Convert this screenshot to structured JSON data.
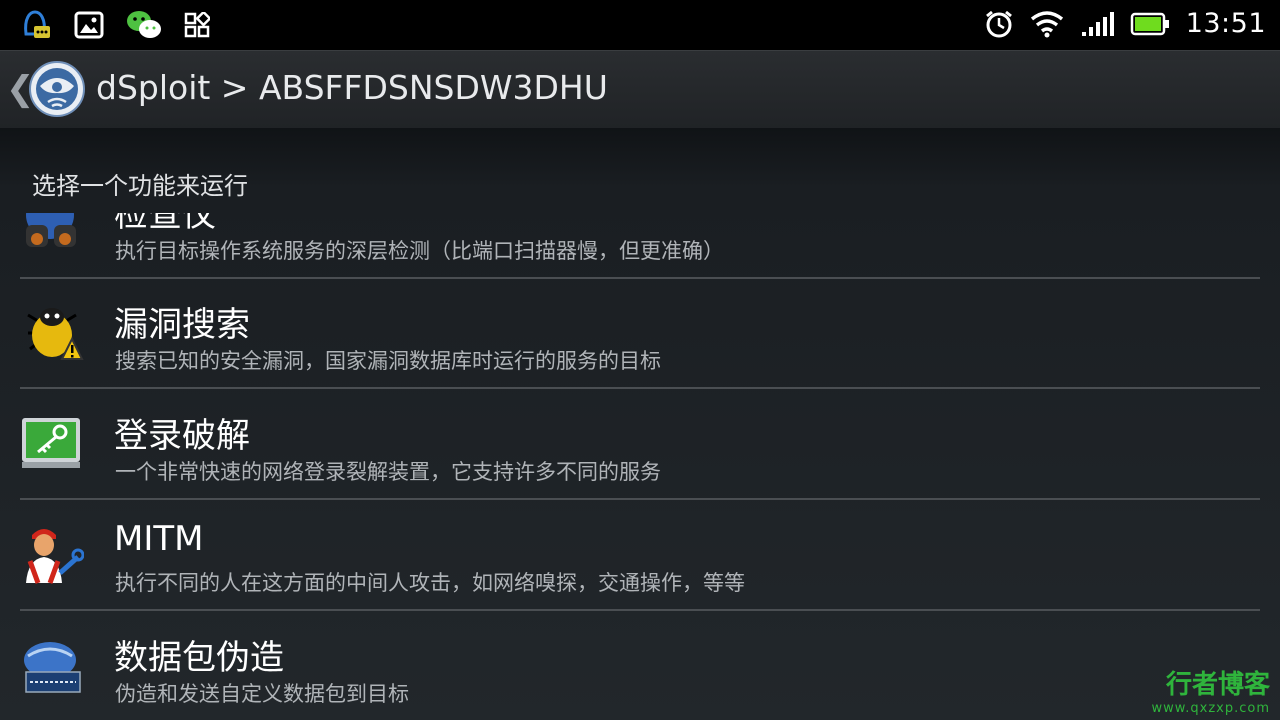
{
  "status_bar": {
    "time": "13:51",
    "left_icons": [
      "qq-icon",
      "gallery-icon",
      "wechat-icon",
      "apps-icon"
    ],
    "right_icons": [
      "alarm-icon",
      "wifi-icon",
      "signal-icon",
      "battery-icon"
    ]
  },
  "action_bar": {
    "back": "❮",
    "title": "dSploit > ABSFFDSNSDW3DHU"
  },
  "section_header": "选择一个功能来运行",
  "items": [
    {
      "title": "检查仪",
      "desc": "执行目标操作系统服务的深层检测（比端口扫描器慢，但更准确）",
      "icon": "binoculars-globe-icon"
    },
    {
      "title": "漏洞搜索",
      "desc": "搜索已知的安全漏洞，国家漏洞数据库时运行的服务的目标",
      "icon": "bug-warning-icon"
    },
    {
      "title": "登录破解",
      "desc": "一个非常快速的网络登录裂解装置，它支持许多不同的服务",
      "icon": "key-screen-icon"
    },
    {
      "title": "MITM",
      "desc": "执行不同的人在这方面的中间人攻击，如网络嗅探，交通操作，等等",
      "icon": "mechanic-icon"
    },
    {
      "title": "数据包伪造",
      "desc": "伪造和发送自定义数据包到目标",
      "icon": "network-packet-icon"
    }
  ],
  "watermark": {
    "main": "行者博客",
    "url": "www.qxzxp.com"
  }
}
